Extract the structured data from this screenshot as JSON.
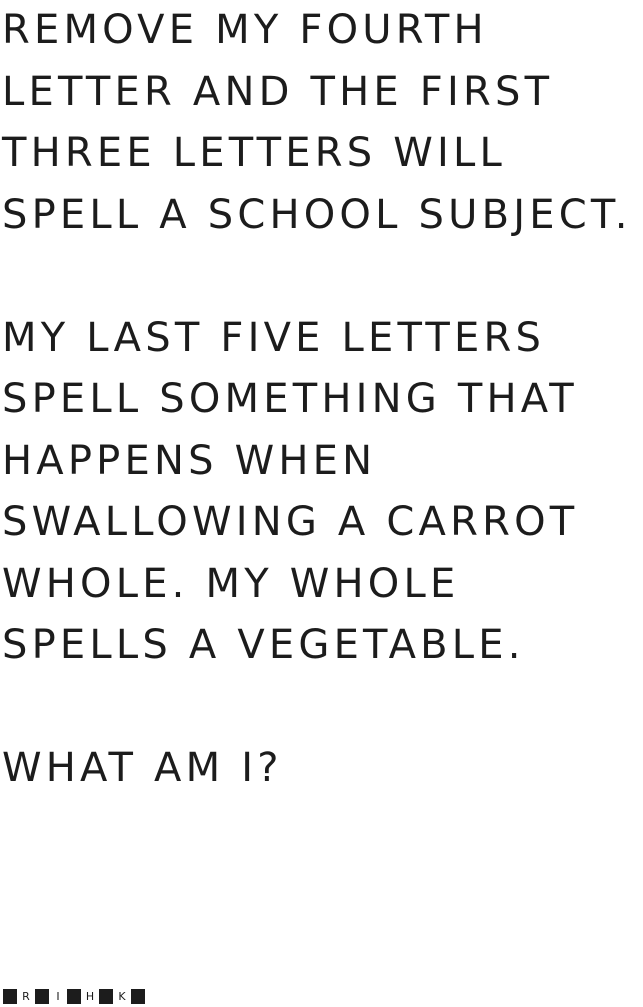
{
  "riddle": {
    "paragraphs": [
      "REMOVE MY FOURTH LETTER AND THE FIRST THREE LETTERS WILL SPELL A SCHOOL SUBJECT.",
      "MY LAST FIVE LETTERS SPELL SOMETHING THAT HAPPENS WHEN SWALLOWING A CARROT WHOLE. MY WHOLE SPELLS A VEGETABLE.",
      "WHAT AM I?"
    ]
  },
  "logo": {
    "letters": [
      "R",
      "I",
      "H",
      "K"
    ]
  },
  "colors": {
    "text": "#1c1c1c",
    "background": "#ffffff"
  }
}
